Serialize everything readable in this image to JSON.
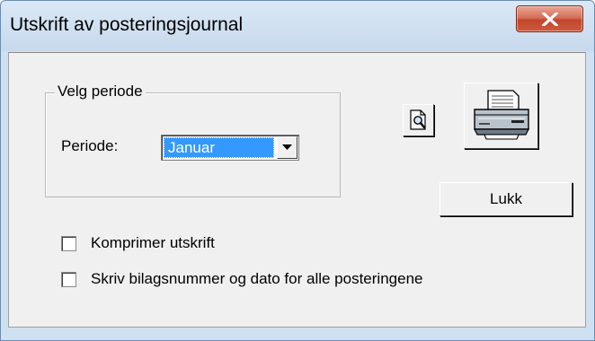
{
  "window": {
    "title": "Utskrift av posteringsjournal",
    "close_icon": "close-x-icon"
  },
  "period_group": {
    "label": "Velg periode",
    "period_label": "Periode:",
    "period_value": "Januar"
  },
  "buttons": {
    "preview_icon": "print-preview-icon",
    "print_icon": "printer-icon",
    "close_label": "Lukk"
  },
  "options": [
    {
      "label": "Komprimer utskrift",
      "checked": false
    },
    {
      "label": "Skriv bilagsnummer og dato for alle posteringene",
      "checked": false
    }
  ],
  "colors": {
    "selection": "#3399ff",
    "close_button": "#c0462c",
    "dialog_background": "#f0f0f0"
  }
}
